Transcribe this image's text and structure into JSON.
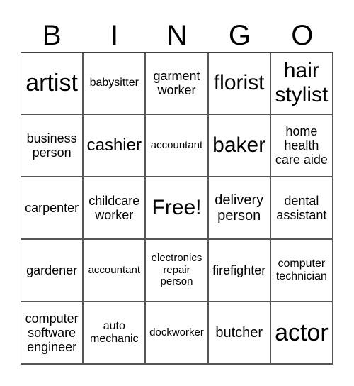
{
  "header": {
    "letters": [
      "B",
      "I",
      "N",
      "G",
      "O"
    ]
  },
  "cells": [
    [
      {
        "text": "artist",
        "size": "s-xl"
      },
      {
        "text": "babysitter",
        "size": "s-xs"
      },
      {
        "text": "garment worker",
        "size": "s-s"
      },
      {
        "text": "florist",
        "size": "s-l"
      },
      {
        "text": "hair stylist",
        "size": "s-l"
      }
    ],
    [
      {
        "text": "business person",
        "size": "s-s"
      },
      {
        "text": "cashier",
        "size": "s-ml"
      },
      {
        "text": "accountant",
        "size": "s-xxs"
      },
      {
        "text": "baker",
        "size": "s-l"
      },
      {
        "text": "home health care aide",
        "size": "s-s"
      }
    ],
    [
      {
        "text": "carpenter",
        "size": "s-s"
      },
      {
        "text": "childcare worker",
        "size": "s-s"
      },
      {
        "text": "Free!",
        "size": "s-l"
      },
      {
        "text": "delivery person",
        "size": "s-m"
      },
      {
        "text": "dental assistant",
        "size": "s-s"
      }
    ],
    [
      {
        "text": "gardener",
        "size": "s-s"
      },
      {
        "text": "accountant",
        "size": "s-xxs"
      },
      {
        "text": "electronics repair person",
        "size": "s-xxs"
      },
      {
        "text": "firefighter",
        "size": "s-s"
      },
      {
        "text": "computer technician",
        "size": "s-xs"
      }
    ],
    [
      {
        "text": "computer software engineer",
        "size": "s-s"
      },
      {
        "text": "auto mechanic",
        "size": "s-xs"
      },
      {
        "text": "dockworker",
        "size": "s-xxs"
      },
      {
        "text": "butcher",
        "size": "s-m"
      },
      {
        "text": "actor",
        "size": "s-xl"
      }
    ]
  ]
}
